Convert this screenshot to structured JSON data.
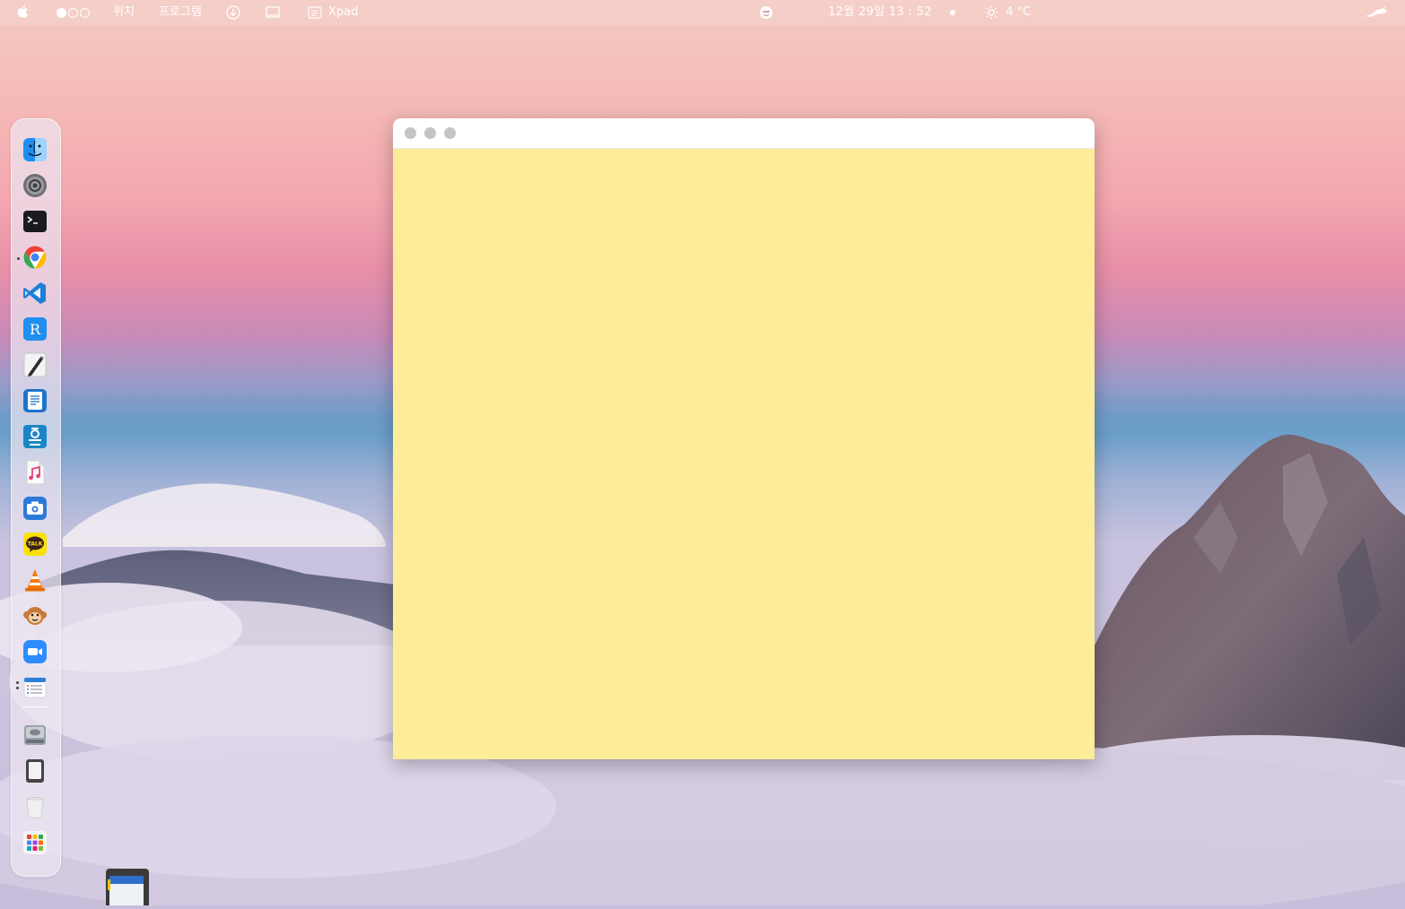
{
  "menubar": {
    "apple": "",
    "places": "위치",
    "programs": "프로그램",
    "active_app": "Xpad",
    "datetime": "12월 29일  13 : 52",
    "temperature": "4 °C"
  },
  "workspaces": {
    "count": 3,
    "active": 1
  },
  "dock": {
    "items": [
      "finder-icon",
      "settings-icon",
      "terminal-icon",
      "chrome-icon",
      "vscode-icon",
      "r-app-icon",
      "text-editor-icon",
      "document-viewer-icon",
      "hangul-icon",
      "music-icon",
      "camera-icon",
      "kakaotalk-icon",
      "vlc-icon",
      "monkey-app-icon",
      "zoom-icon",
      "xpad-icon",
      "disk-icon",
      "sd-card-icon",
      "trash-icon",
      "app-grid-icon"
    ]
  },
  "window": {
    "title": "",
    "note_text": "",
    "note_color": "#fdec99"
  },
  "colors": {
    "note": "#fdec99",
    "titlebar": "#ffffff",
    "traffic_light": "#c4c4c4"
  }
}
